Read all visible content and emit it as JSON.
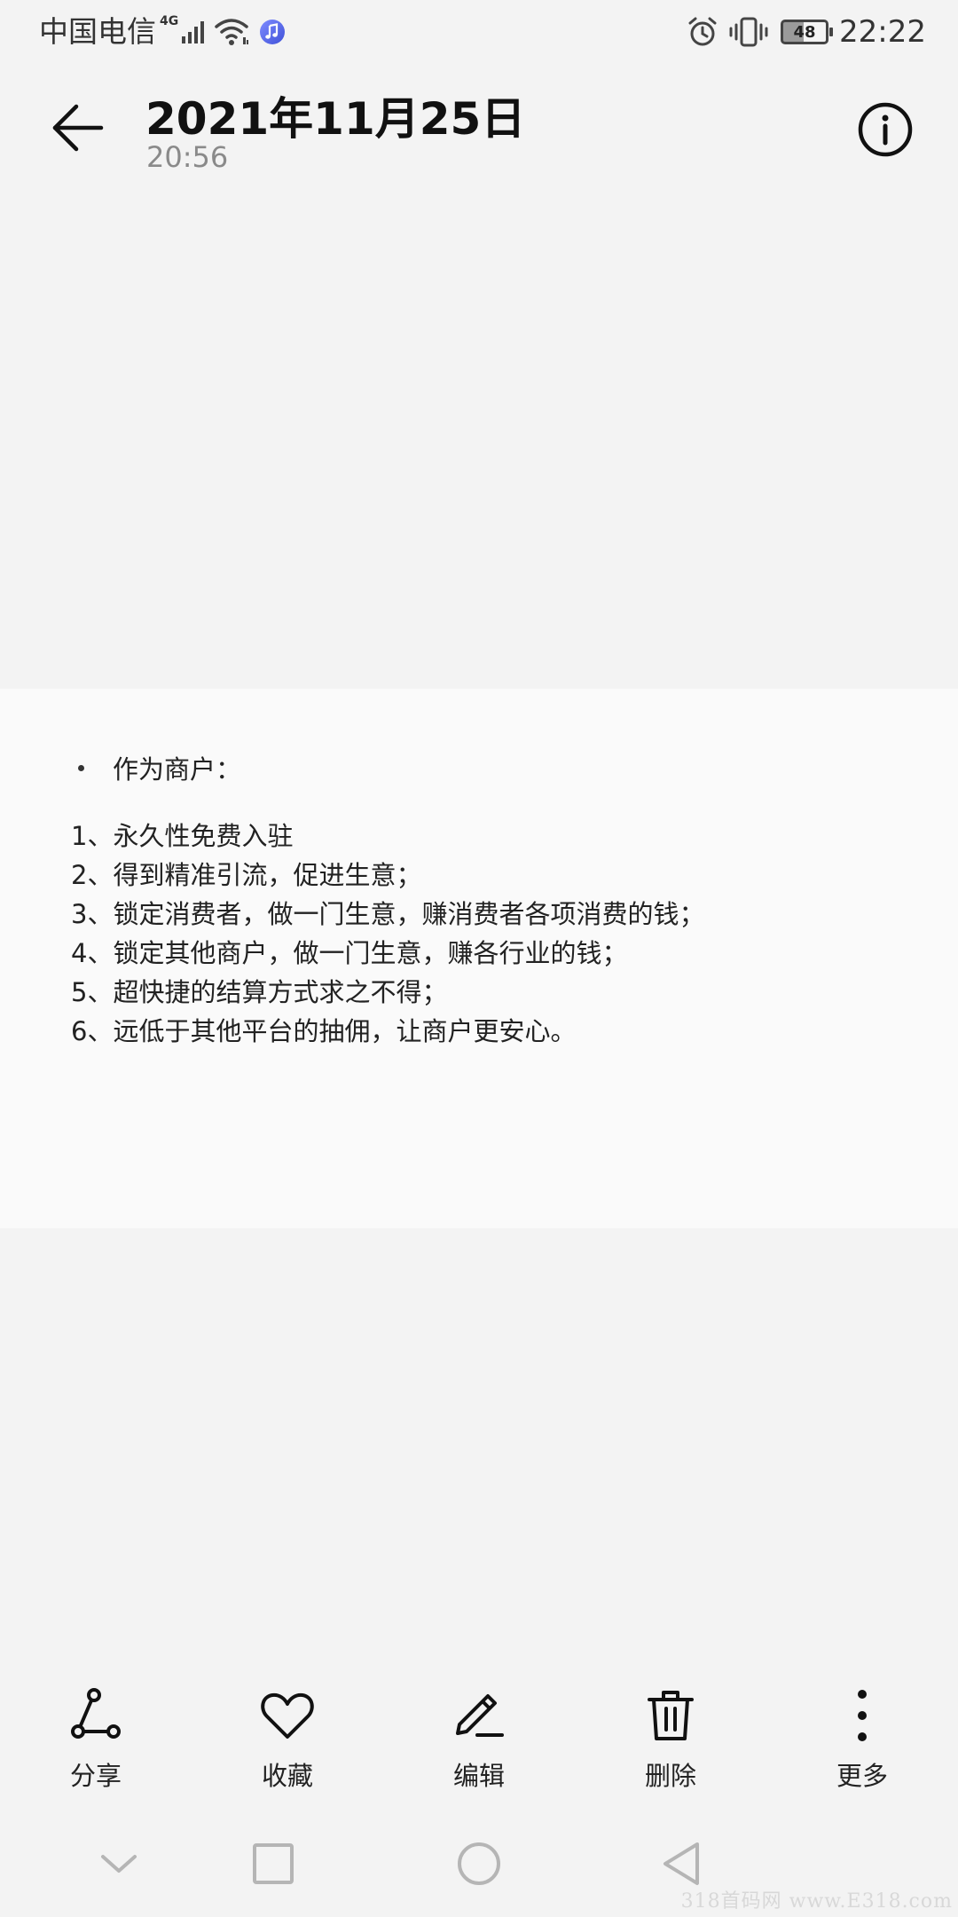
{
  "status_bar": {
    "carrier": "中国电信",
    "network_type": "4G",
    "battery_level": "48",
    "time": "22:22",
    "icons": [
      "signal-icon",
      "wifi-icon",
      "music-icon",
      "alarm-icon",
      "vibrate-icon",
      "battery-icon"
    ]
  },
  "header": {
    "title": "2021年11月25日",
    "time": "20:56",
    "icons": [
      "back-arrow-icon",
      "info-icon"
    ]
  },
  "note": {
    "heading": "作为商户：",
    "items": [
      "1、永久性免费入驻",
      "2、得到精准引流，促进生意；",
      "3、锁定消费者，做一门生意，赚消费者各项消费的钱；",
      "4、锁定其他商户，做一门生意，赚各行业的钱；",
      "5、超快捷的结算方式求之不得；",
      "6、远低于其他平台的抽佣，让商户更安心。"
    ]
  },
  "toolbar": {
    "share": "分享",
    "favorite": "收藏",
    "edit": "编辑",
    "delete": "删除",
    "more": "更多"
  },
  "nav_bar": {
    "icons": [
      "collapse-chevron-icon",
      "recents-square-icon",
      "home-circle-icon",
      "back-triangle-icon"
    ]
  },
  "watermark": "318首码网 www.E318.com"
}
